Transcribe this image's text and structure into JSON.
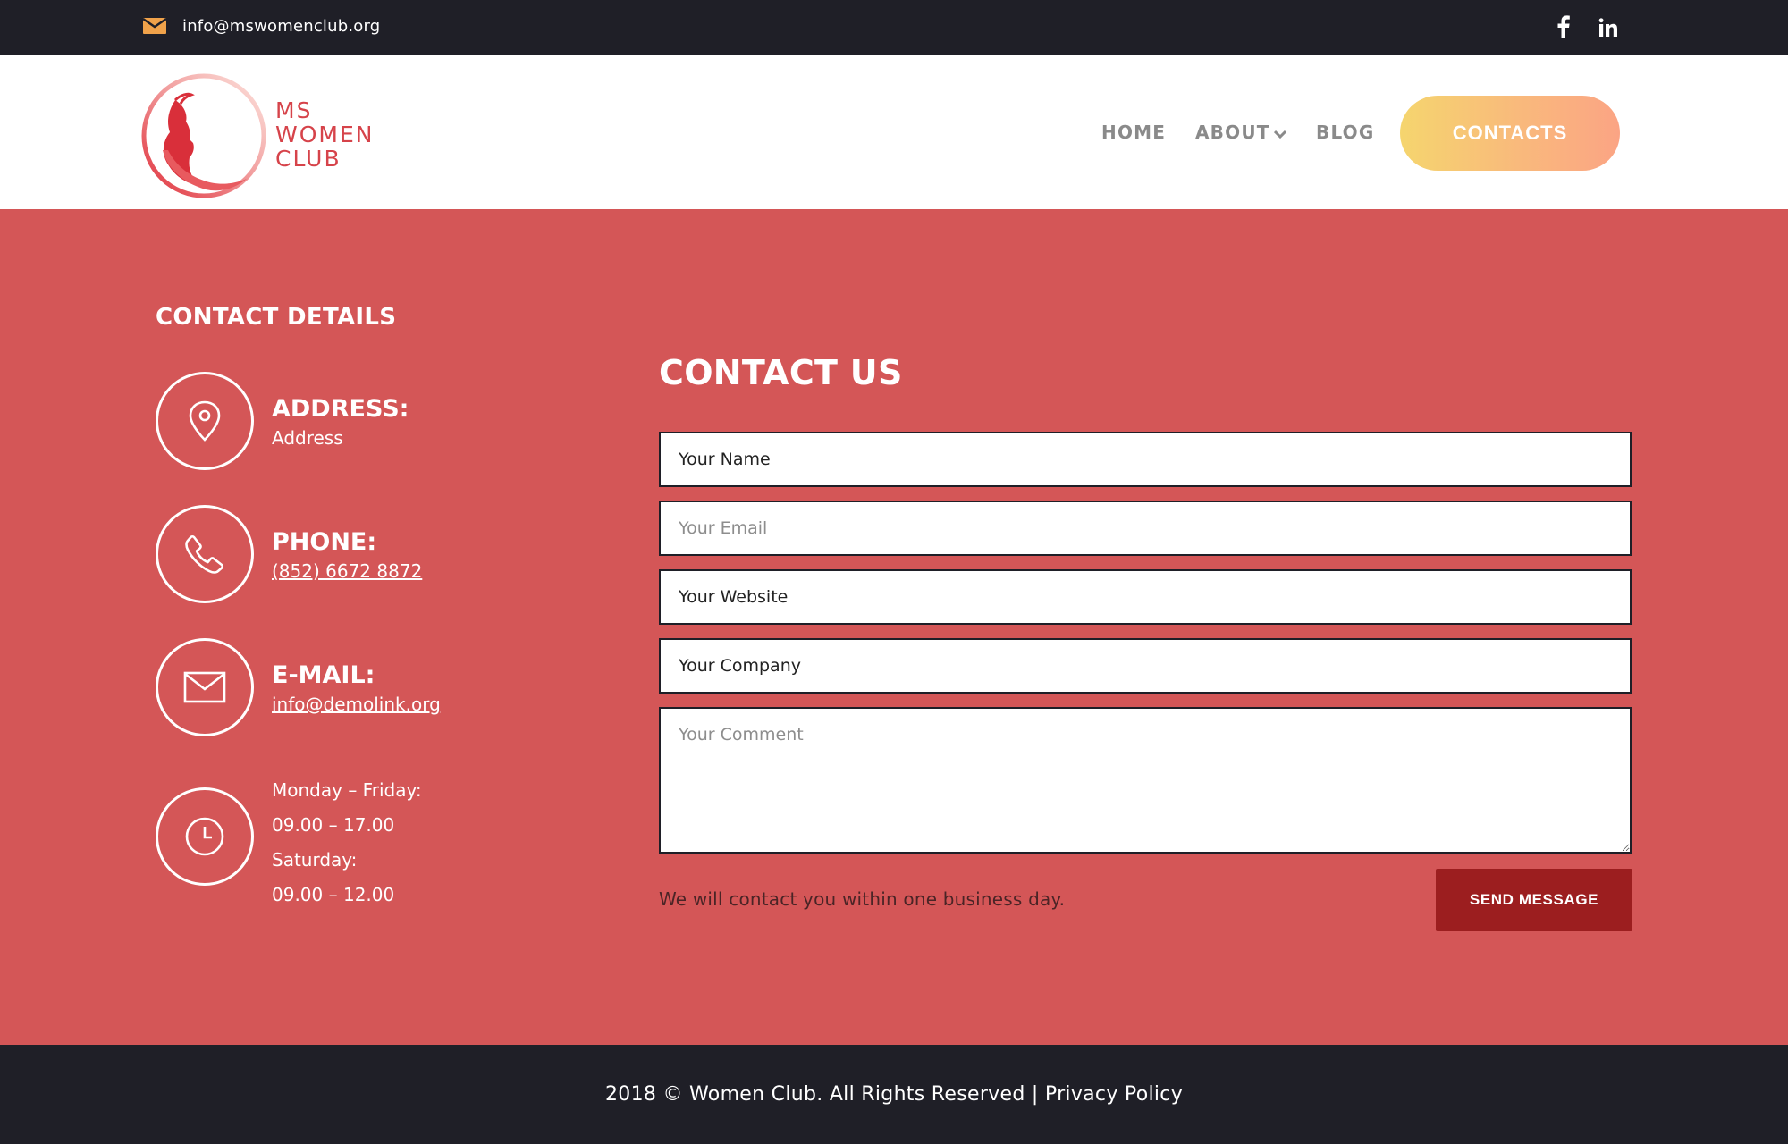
{
  "topbar": {
    "email": "info@mswomenclub.org",
    "icons": [
      "mail-icon",
      "facebook-icon",
      "linkedin-icon"
    ]
  },
  "header": {
    "logo": {
      "line1": "MS",
      "line2": "WOMEN",
      "line3": "CLUB"
    },
    "nav": {
      "home": "HOME",
      "about": "ABOUT",
      "blog": "BLOG",
      "contacts": "CONTACTS"
    }
  },
  "details": {
    "title": "CONTACT DETAILS",
    "address": {
      "label": "ADDRESS:",
      "value": "Address"
    },
    "phone": {
      "label": "PHONE:",
      "value": "(852) 6672 8872"
    },
    "email": {
      "label": "E-MAIL:",
      "value": "info@demolink.org"
    },
    "hours": {
      "line1": "Monday – Friday:",
      "line2": "09.00 – 17.00",
      "line3": "Saturday:",
      "line4": "09.00 – 12.00"
    }
  },
  "form": {
    "title": "CONTACT US",
    "name_placeholder": "Your Name",
    "email_placeholder": "Your Email",
    "website_placeholder": "Your Website",
    "company_placeholder": "Your Company",
    "comment_placeholder": "Your Comment",
    "note": "We will contact you within one business day.",
    "submit_label": "SEND MESSAGE"
  },
  "footer": {
    "copyright": "2018 © Women Club. All Rights Reserved | Privacy Policy"
  },
  "colors": {
    "dark": "#1f1f27",
    "red": "#d45657",
    "button_dark_red": "#9c1e1f",
    "accent_orange": "#f0a24a",
    "logo_red": "#d6434a"
  }
}
